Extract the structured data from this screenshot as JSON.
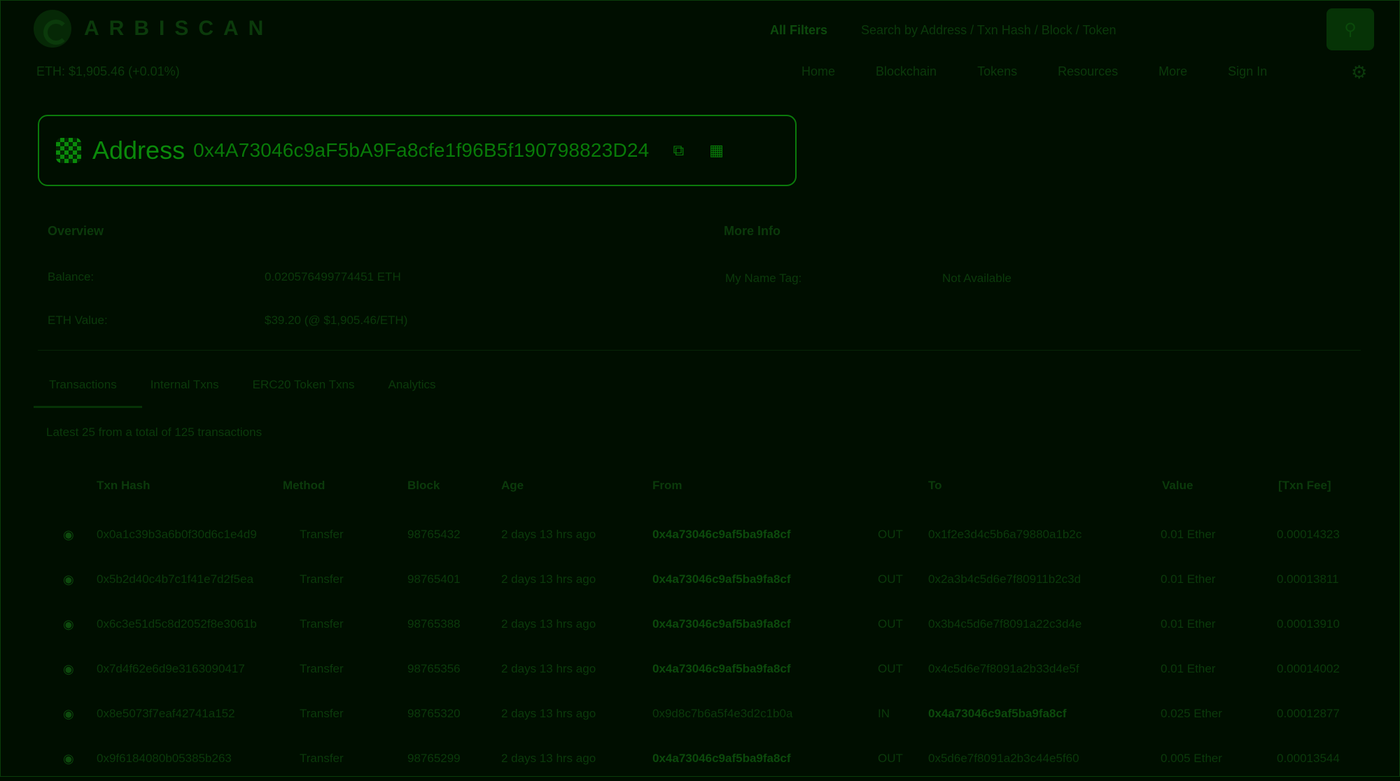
{
  "header": {
    "logo_text": "ARBISCAN",
    "price": "ETH: $1,905.46 (+0.01%)",
    "search_filter": "All Filters",
    "search_placeholder": "Search by Address / Txn Hash / Block / Token",
    "search_button_icon": "search-icon",
    "nav": [
      "Home",
      "Blockchain",
      "Tokens",
      "Resources",
      "More",
      "Sign In"
    ],
    "settings_icon": "gear-icon"
  },
  "address": {
    "label": "Address",
    "hash": "0x4A73046c9aF5bA9Fa8cfe1f96B5f190798823D24",
    "copy_icon": "copy-icon",
    "qr_icon": "qr-icon"
  },
  "overview": {
    "title": "Overview",
    "balance_label": "Balance:",
    "balance_value": "0.020576499774451 ETH",
    "value_label": "ETH Value:",
    "value_value": "$39.20 (@ $1,905.46/ETH)"
  },
  "more_info": {
    "title": "More Info",
    "name_tag": "My Name Tag:",
    "name_tag_value": "Not Available"
  },
  "tabs": [
    "Transactions",
    "Internal Txns",
    "ERC20 Token Txns",
    "Analytics"
  ],
  "latest": "Latest 25 from a total of 125 transactions",
  "table": {
    "headers": [
      "Txn Hash",
      "Method",
      "Block",
      "Age",
      "From",
      "",
      "To",
      "Value",
      "[Txn Fee]"
    ],
    "rows": [
      [
        "0x0a1c39b3a6b0f30d6c1e4d9",
        "Transfer",
        "98765432",
        "2 days 13 hrs ago",
        "0x4a73046c9af5ba9fa8cf",
        "OUT",
        "0x1f2e3d4c5b6a79880a1b2c",
        "0.01 Ether",
        "0.00014323"
      ],
      [
        "0x5b2d40c4b7c1f41e7d2f5ea",
        "Transfer",
        "98765401",
        "2 days 13 hrs ago",
        "0x4a73046c9af5ba9fa8cf",
        "OUT",
        "0x2a3b4c5d6e7f80911b2c3d",
        "0.01 Ether",
        "0.00013811"
      ],
      [
        "0x6c3e51d5c8d2052f8e3061b",
        "Transfer",
        "98765388",
        "2 days 13 hrs ago",
        "0x4a73046c9af5ba9fa8cf",
        "OUT",
        "0x3b4c5d6e7f8091a22c3d4e",
        "0.01 Ether",
        "0.00013910"
      ],
      [
        "0x7d4f62e6d9e3163090417",
        "Transfer",
        "98765356",
        "2 days 13 hrs ago",
        "0x4a73046c9af5ba9fa8cf",
        "OUT",
        "0x4c5d6e7f8091a2b33d4e5f",
        "0.01 Ether",
        "0.00014002"
      ],
      [
        "0x8e5073f7eaf42741a152",
        "Transfer",
        "98765320",
        "2 days 13 hrs ago",
        "0x9d8c7b6a5f4e3d2c1b0a",
        "IN",
        "0x4a73046c9af5ba9fa8cf",
        "0.025 Ether",
        "0.00012877"
      ],
      [
        "0x9f6184080b05385b263",
        "Transfer",
        "98765299",
        "2 days 13 hrs ago",
        "0x4a73046c9af5ba9fa8cf",
        "OUT",
        "0x5d6e7f8091a2b3c44e5f60",
        "0.005 Ether",
        "0.00013544"
      ]
    ]
  }
}
